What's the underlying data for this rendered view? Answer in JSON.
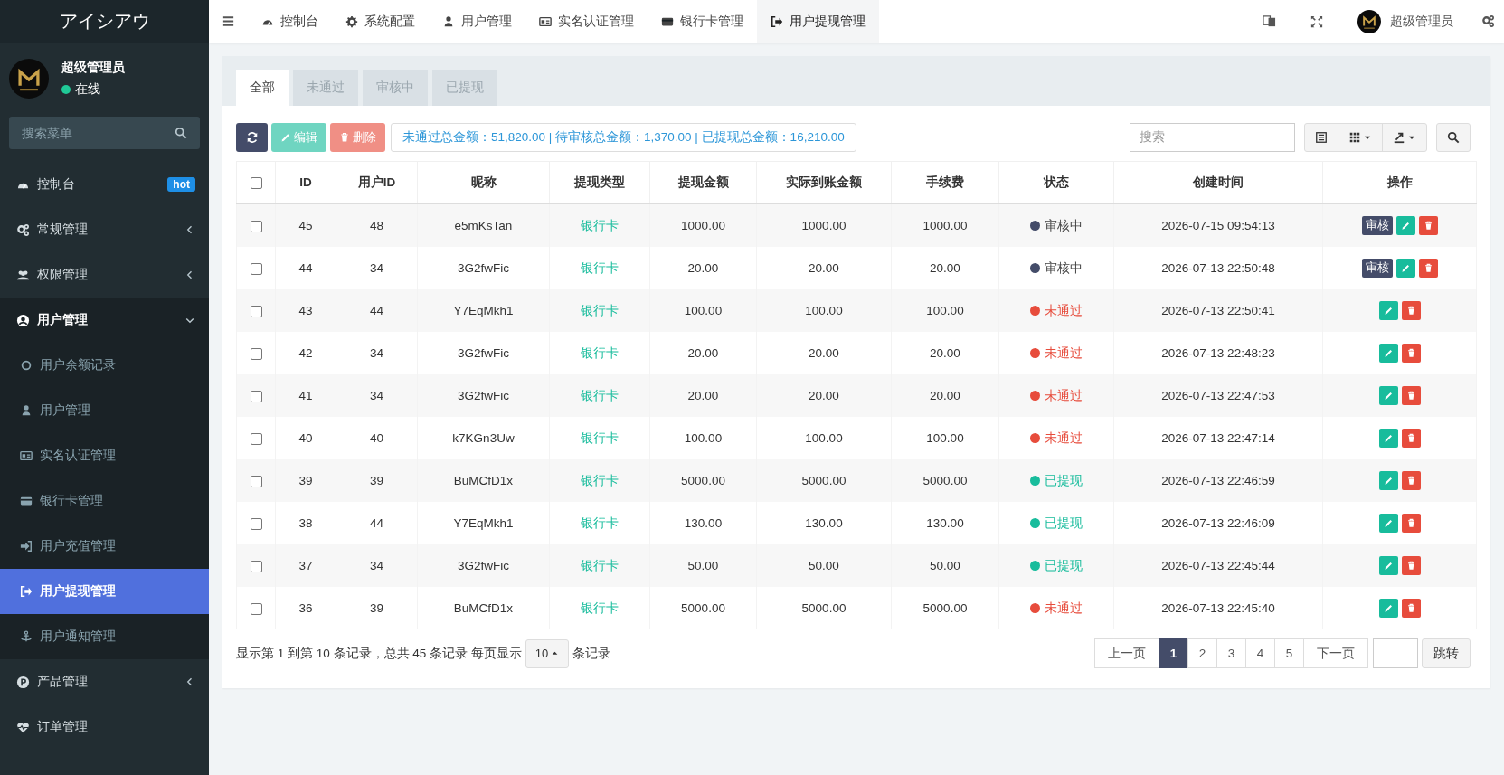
{
  "sidebar": {
    "logo": "アイシアウ",
    "user": {
      "name": "超级管理员",
      "status": "在线",
      "online": true
    },
    "search": {
      "placeholder": "搜索菜单"
    },
    "items": [
      {
        "kind": "link",
        "label": "控制台",
        "badge": "hot",
        "selected": false
      },
      {
        "kind": "group",
        "label": "常规管理",
        "expanded": false,
        "selected": false
      },
      {
        "kind": "group",
        "label": "权限管理",
        "expanded": false,
        "selected": false
      },
      {
        "kind": "group",
        "label": "用户管理",
        "expanded": true,
        "selected": false,
        "children": [
          {
            "label": "用户余额记录",
            "selected": false
          },
          {
            "label": "用户管理",
            "selected": false
          },
          {
            "label": "实名认证管理",
            "selected": false
          },
          {
            "label": "银行卡管理",
            "selected": false
          },
          {
            "label": "用户充值管理",
            "selected": false
          },
          {
            "label": "用户提现管理",
            "selected": true
          },
          {
            "label": "用户通知管理",
            "selected": false
          }
        ]
      },
      {
        "kind": "group",
        "label": "产品管理",
        "expanded": false,
        "selected": false
      },
      {
        "kind": "link",
        "label": "订单管理",
        "selected": false
      }
    ]
  },
  "topbar": {
    "tabs": [
      {
        "label": "控制台",
        "selected": false
      },
      {
        "label": "系统配置",
        "selected": false
      },
      {
        "label": "用户管理",
        "selected": false
      },
      {
        "label": "实名认证管理",
        "selected": false
      },
      {
        "label": "银行卡管理",
        "selected": false
      },
      {
        "label": "用户提现管理",
        "selected": true
      }
    ],
    "user": "超级管理员"
  },
  "panel": {
    "tabs": [
      {
        "label": "全部",
        "selected": true
      },
      {
        "label": "未通过",
        "selected": false
      },
      {
        "label": "审核中",
        "selected": false
      },
      {
        "label": "已提现",
        "selected": false
      }
    ],
    "toolbar": {
      "edit": {
        "label": "编辑",
        "disabled": true
      },
      "delete": {
        "label": "删除",
        "disabled": true
      },
      "summary": "未通过总金额：51,820.00 | 待审核总金额：1,370.00 | 已提现总金额：16,210.00",
      "search": {
        "placeholder": "搜索"
      }
    },
    "table": {
      "select_all": false,
      "columns": [
        "ID",
        "用户ID",
        "昵称",
        "提现类型",
        "提现金额",
        "实际到账金额",
        "手续费",
        "状态",
        "创建时间",
        "操作"
      ],
      "rows": [
        {
          "checked": false,
          "cells": [
            "45",
            "48",
            "e5mKsTan",
            "银行卡",
            "1000.00",
            "1000.00",
            "1000.00"
          ],
          "status": {
            "label": "审核中",
            "color": "#444c69"
          },
          "time": "2026-07-15 09:54:13",
          "actions": [
            {
              "kind": "review",
              "label": "审核"
            },
            {
              "kind": "edit"
            },
            {
              "kind": "delete"
            }
          ]
        },
        {
          "checked": false,
          "cells": [
            "44",
            "34",
            "3G2fwFic",
            "银行卡",
            "20.00",
            "20.00",
            "20.00"
          ],
          "status": {
            "label": "审核中",
            "color": "#444c69"
          },
          "time": "2026-07-13 22:50:48",
          "actions": [
            {
              "kind": "review",
              "label": "审核"
            },
            {
              "kind": "edit"
            },
            {
              "kind": "delete"
            }
          ]
        },
        {
          "checked": false,
          "cells": [
            "43",
            "44",
            "Y7EqMkh1",
            "银行卡",
            "100.00",
            "100.00",
            "100.00"
          ],
          "status": {
            "label": "未通过",
            "color": "#e74c3c"
          },
          "time": "2026-07-13 22:50:41",
          "actions": [
            {
              "kind": "edit"
            },
            {
              "kind": "delete"
            }
          ]
        },
        {
          "checked": false,
          "cells": [
            "42",
            "34",
            "3G2fwFic",
            "银行卡",
            "20.00",
            "20.00",
            "20.00"
          ],
          "status": {
            "label": "未通过",
            "color": "#e74c3c"
          },
          "time": "2026-07-13 22:48:23",
          "actions": [
            {
              "kind": "edit"
            },
            {
              "kind": "delete"
            }
          ]
        },
        {
          "checked": false,
          "cells": [
            "41",
            "34",
            "3G2fwFic",
            "银行卡",
            "20.00",
            "20.00",
            "20.00"
          ],
          "status": {
            "label": "未通过",
            "color": "#e74c3c"
          },
          "time": "2026-07-13 22:47:53",
          "actions": [
            {
              "kind": "edit"
            },
            {
              "kind": "delete"
            }
          ]
        },
        {
          "checked": false,
          "cells": [
            "40",
            "40",
            "k7KGn3Uw",
            "银行卡",
            "100.00",
            "100.00",
            "100.00"
          ],
          "status": {
            "label": "未通过",
            "color": "#e74c3c"
          },
          "time": "2026-07-13 22:47:14",
          "actions": [
            {
              "kind": "edit"
            },
            {
              "kind": "delete"
            }
          ]
        },
        {
          "checked": false,
          "cells": [
            "39",
            "39",
            "BuMCfD1x",
            "银行卡",
            "5000.00",
            "5000.00",
            "5000.00"
          ],
          "status": {
            "label": "已提现",
            "color": "#18bc9c"
          },
          "time": "2026-07-13 22:46:59",
          "actions": [
            {
              "kind": "edit"
            },
            {
              "kind": "delete"
            }
          ]
        },
        {
          "checked": false,
          "cells": [
            "38",
            "44",
            "Y7EqMkh1",
            "银行卡",
            "130.00",
            "130.00",
            "130.00"
          ],
          "status": {
            "label": "已提现",
            "color": "#18bc9c"
          },
          "time": "2026-07-13 22:46:09",
          "actions": [
            {
              "kind": "edit"
            },
            {
              "kind": "delete"
            }
          ]
        },
        {
          "checked": false,
          "cells": [
            "37",
            "34",
            "3G2fwFic",
            "银行卡",
            "50.00",
            "50.00",
            "50.00"
          ],
          "status": {
            "label": "已提现",
            "color": "#18bc9c"
          },
          "time": "2026-07-13 22:45:44",
          "actions": [
            {
              "kind": "edit"
            },
            {
              "kind": "delete"
            }
          ]
        },
        {
          "checked": false,
          "cells": [
            "36",
            "39",
            "BuMCfD1x",
            "银行卡",
            "5000.00",
            "5000.00",
            "5000.00"
          ],
          "status": {
            "label": "未通过",
            "color": "#e74c3c"
          },
          "time": "2026-07-13 22:45:40",
          "actions": [
            {
              "kind": "edit"
            },
            {
              "kind": "delete"
            }
          ]
        }
      ]
    },
    "footer": {
      "info": "显示第 1 到第 10 条记录，总共 45 条记录 每页显示",
      "page_size": "10",
      "suffix": "条记录",
      "prev": "上一页",
      "pages": [
        {
          "label": "1",
          "selected": true
        },
        {
          "label": "2",
          "selected": false
        },
        {
          "label": "3",
          "selected": false
        },
        {
          "label": "4",
          "selected": false
        },
        {
          "label": "5",
          "selected": false
        }
      ],
      "next": "下一页",
      "jump": "跳转"
    }
  }
}
